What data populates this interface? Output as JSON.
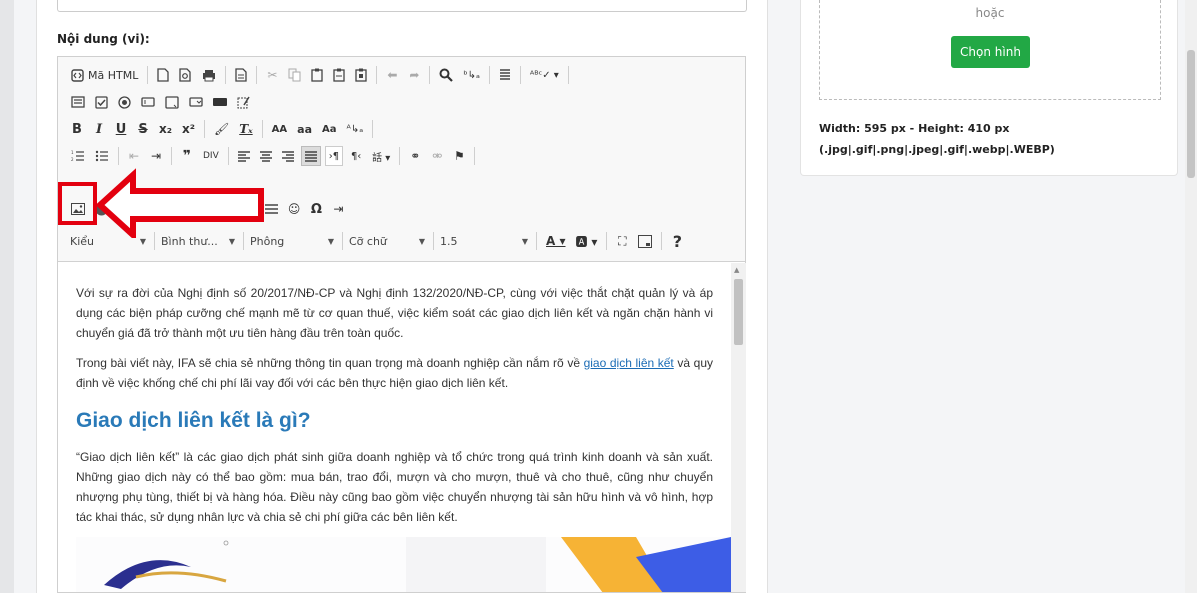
{
  "content_label": "Nội dung (vi):",
  "toolbar": {
    "html_button": "Mã HTML",
    "bold": "B",
    "italic": "I",
    "underline": "U",
    "strike": "S",
    "subscript": "x₂",
    "superscript": "x²",
    "upper": "AA",
    "lower": "aa",
    "title_case": "Aa",
    "help": "?",
    "styles_dd": "Kiểu",
    "format_dd": "Bình thư...",
    "font_dd": "Phông",
    "size_dd": "Cỡ chữ",
    "line_height_dd": "1.5"
  },
  "article": {
    "p1": "Với sự ra đời của Nghị định số 20/2017/NĐ-CP và Nghị định 132/2020/NĐ-CP, cùng với việc thắt chặt quản lý và áp dụng các biện pháp cưỡng chế mạnh mẽ từ cơ quan thuế, việc kiểm soát các giao dịch liên kết và ngăn chặn hành vi chuyển giá đã trở thành một ưu tiên hàng đầu trên toàn quốc.",
    "p2_before": "Trong bài viết này, IFA sẽ chia sẻ những thông tin quan trọng mà doanh nghiệp cần nắm rõ về ",
    "p2_link": "giao dịch liên kết",
    "p2_after": " và quy định về việc khống chế chi phí lãi vay đối với các bên thực hiện giao dịch liên kết.",
    "heading": "Giao dịch liên kết là gì?",
    "p3": "“Giao dịch liên kết” là các giao dịch phát sinh giữa doanh nghiệp và tổ chức trong quá trình kinh doanh và sản xuất. Những giao dịch này có thể bao gồm: mua bán, trao đổi, mượn và cho mượn, thuê và cho thuê, cũng như chuyển nhượng phụ tùng, thiết bị và hàng hóa. Điều này cũng bao gồm việc chuyển nhượng tài sản hữu hình và vô hình, hợp tác khai thác, sử dụng nhân lực và chia sẻ chi phí giữa các bên liên kết."
  },
  "side": {
    "or_text": "hoặc",
    "choose_button": "Chọn hình",
    "size_text": "Width: 595 px - Height: 410 px",
    "formats_text": "(.jpg|.gif|.png|.jpeg|.gif|.webp|.WEBP)"
  },
  "colors": {
    "highlight": "#e3000f",
    "button_green": "#22a845",
    "heading_blue": "#2a7ab8",
    "link_blue": "#1b6cb5"
  }
}
